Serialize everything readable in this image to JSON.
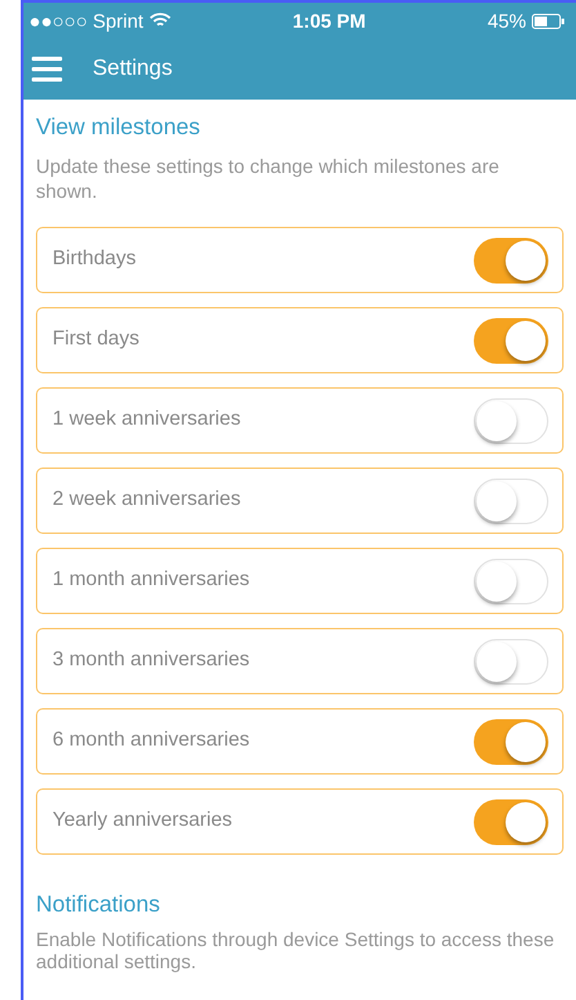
{
  "status_bar": {
    "carrier": "●●○○○ Sprint",
    "time": "1:05 PM",
    "battery": "45%"
  },
  "header": {
    "title": "Settings"
  },
  "milestones": {
    "heading": "View milestones",
    "description": "Update these settings to change which milestones are shown.",
    "items": [
      {
        "label": "Birthdays",
        "on": true
      },
      {
        "label": "First days",
        "on": true
      },
      {
        "label": "1 week anniversaries",
        "on": false
      },
      {
        "label": "2 week anniversaries",
        "on": false
      },
      {
        "label": "1 month anniversaries",
        "on": false
      },
      {
        "label": "3 month anniversaries",
        "on": false
      },
      {
        "label": "6 month anniversaries",
        "on": true
      },
      {
        "label": "Yearly anniversaries",
        "on": true
      }
    ]
  },
  "notifications": {
    "heading": "Notifications",
    "description": "Enable Notifications through device Settings to access these additional settings."
  }
}
